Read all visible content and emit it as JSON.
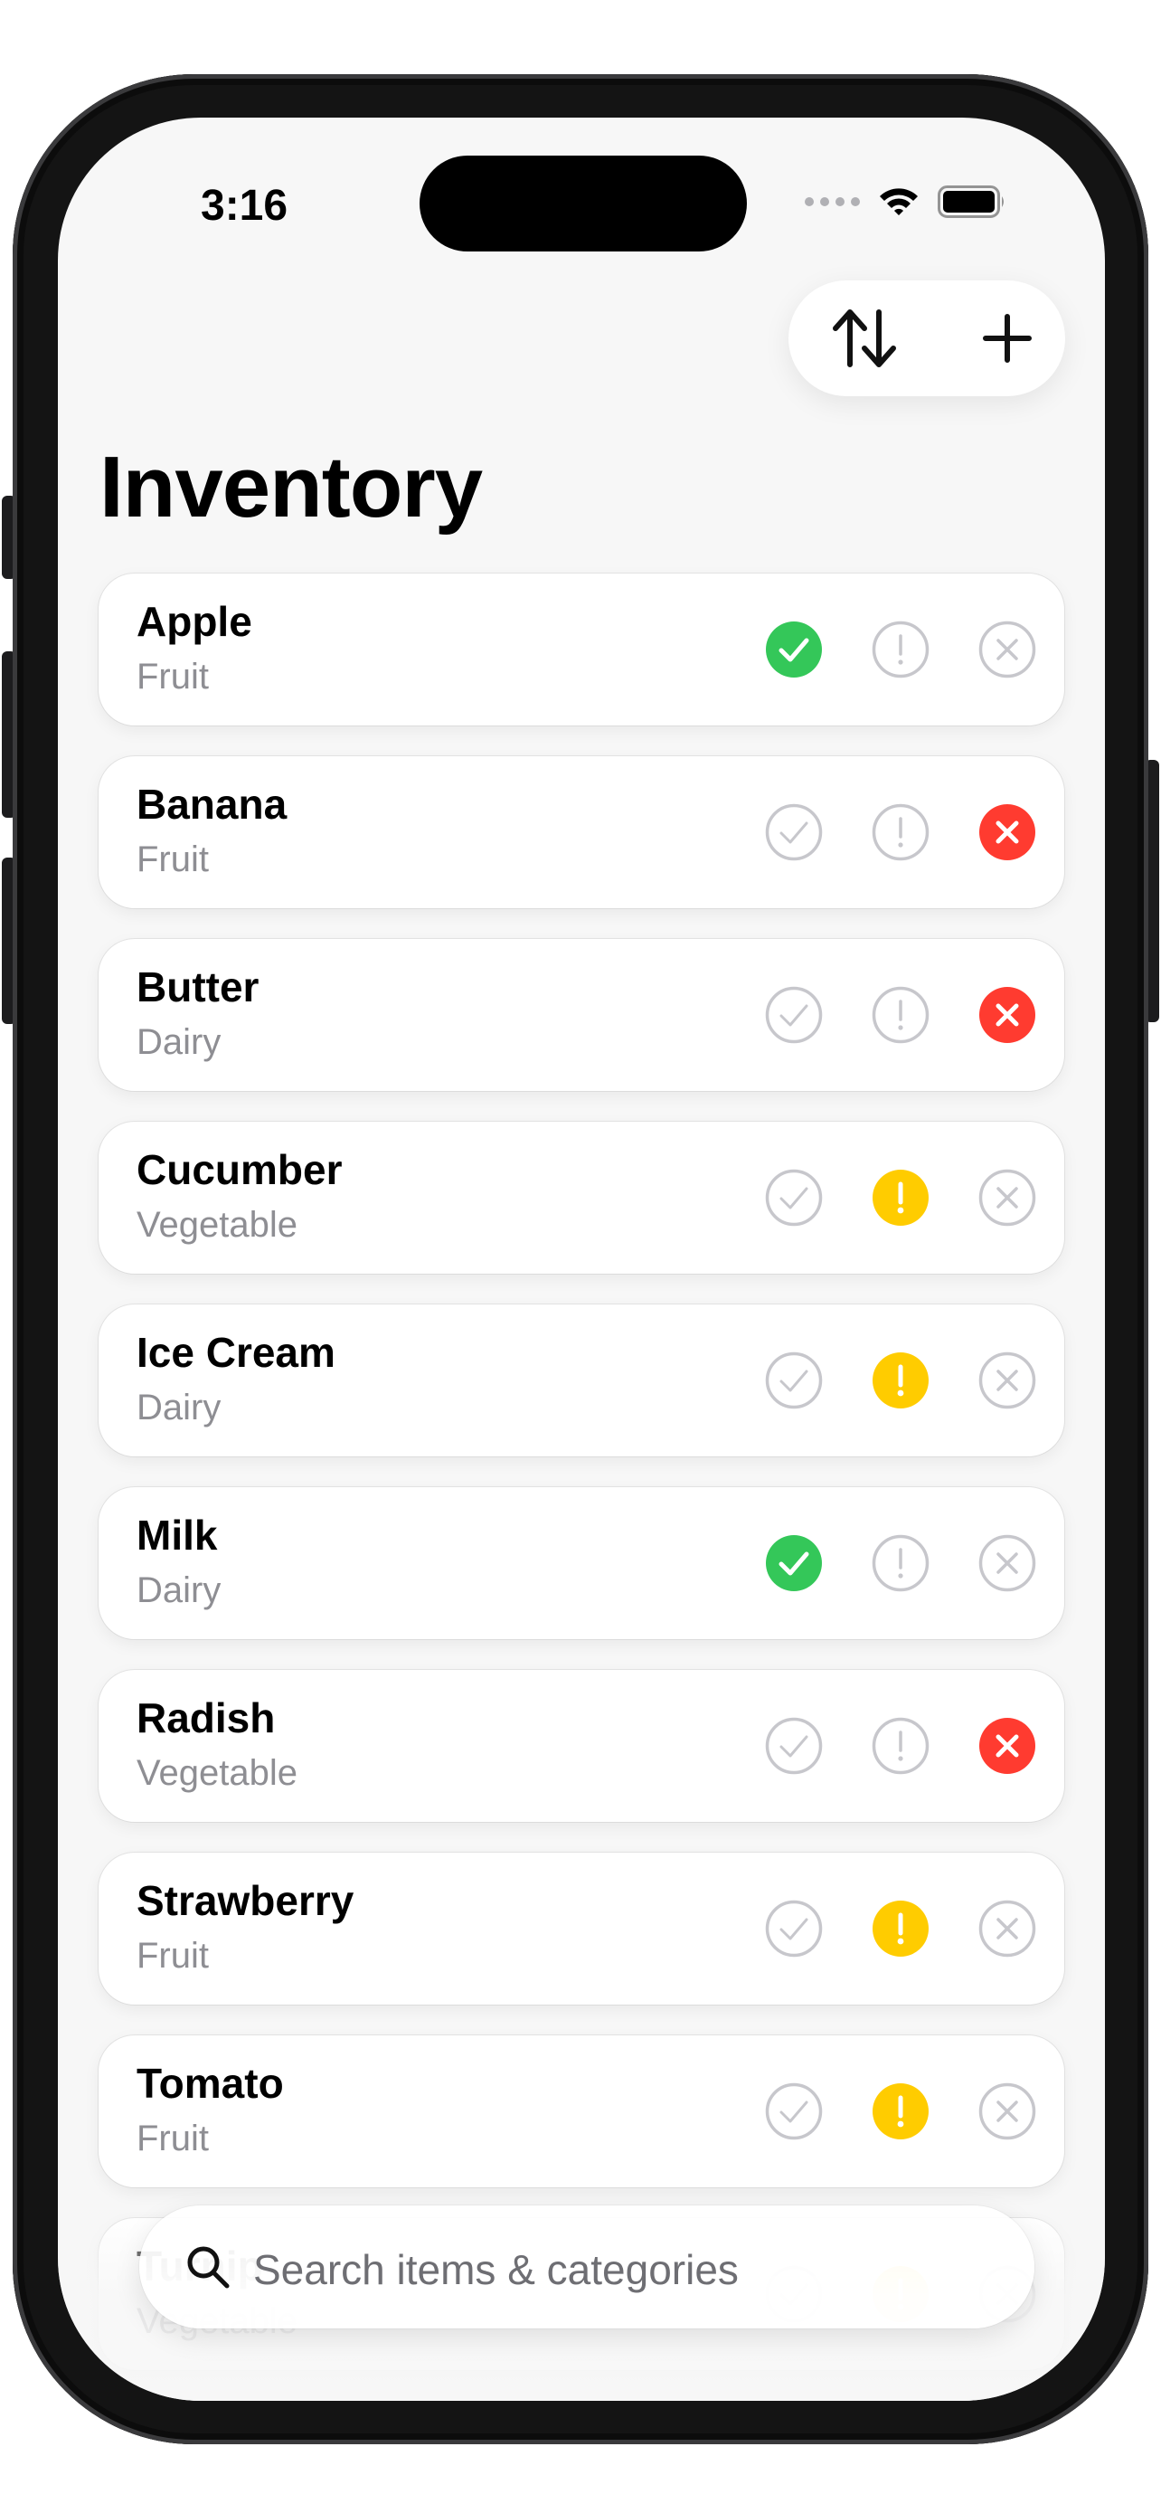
{
  "status_bar": {
    "time": "3:16"
  },
  "toolbar": {
    "sort_icon": "arrow-up-down-icon",
    "add_icon": "plus-icon"
  },
  "page": {
    "title": "Inventory"
  },
  "colors": {
    "ok": "#34c759",
    "warn": "#ffcc00",
    "out": "#ff3b30",
    "inactive": "#c7c7cc"
  },
  "items": [
    {
      "name": "Apple",
      "category": "Fruit",
      "status": "ok"
    },
    {
      "name": "Banana",
      "category": "Fruit",
      "status": "out"
    },
    {
      "name": "Butter",
      "category": "Dairy",
      "status": "out"
    },
    {
      "name": "Cucumber",
      "category": "Vegetable",
      "status": "warn"
    },
    {
      "name": "Ice Cream",
      "category": "Dairy",
      "status": "warn"
    },
    {
      "name": "Milk",
      "category": "Dairy",
      "status": "ok"
    },
    {
      "name": "Radish",
      "category": "Vegetable",
      "status": "out"
    },
    {
      "name": "Strawberry",
      "category": "Fruit",
      "status": "warn"
    },
    {
      "name": "Tomato",
      "category": "Fruit",
      "status": "warn"
    },
    {
      "name": "Turnip",
      "category": "Vegetable",
      "status": "warn"
    }
  ],
  "search": {
    "placeholder": "Search items & categories"
  }
}
